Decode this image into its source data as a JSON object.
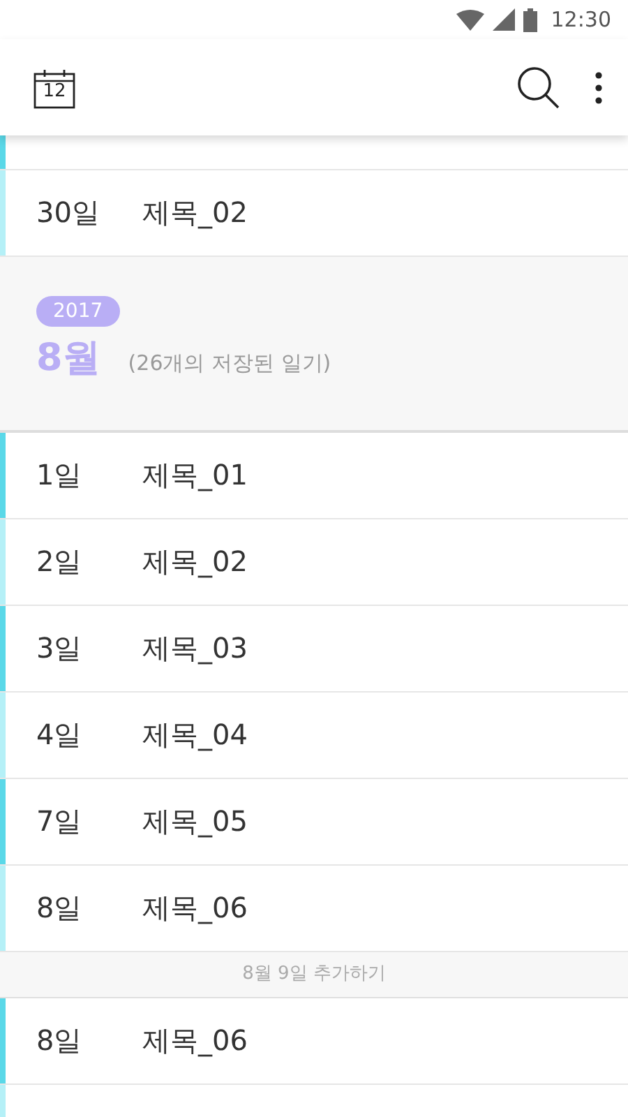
{
  "status_bar": {
    "time": "12:30"
  },
  "toolbar": {
    "calendar_day": "12"
  },
  "clipped_row": {
    "color": "#5ad8e8"
  },
  "previous_entries": [
    {
      "day": "30일",
      "title": "제목_02",
      "color": "#b5f0f7"
    }
  ],
  "month_header": {
    "year": "2017",
    "month": "8월",
    "count": "(26개의 저장된 일기)"
  },
  "entries": [
    {
      "kind": "entry",
      "day": "1일",
      "title": "제목_01",
      "color": "#5ad8e8"
    },
    {
      "kind": "entry",
      "day": "2일",
      "title": "제목_02",
      "color": "#b5f0f7"
    },
    {
      "kind": "entry",
      "day": "3일",
      "title": "제목_03",
      "color": "#5ad8e8"
    },
    {
      "kind": "entry",
      "day": "4일",
      "title": "제목_04",
      "color": "#b5f0f7"
    },
    {
      "kind": "entry",
      "day": "7일",
      "title": "제목_05",
      "color": "#5ad8e8"
    },
    {
      "kind": "entry",
      "day": "8일",
      "title": "제목_06",
      "color": "#b5f0f7"
    },
    {
      "kind": "add",
      "label": "8월 9일 추가하기"
    },
    {
      "kind": "entry",
      "day": "8일",
      "title": "제목_06",
      "color": "#5ad8e8"
    },
    {
      "kind": "entry",
      "color": "#b5f0f7"
    }
  ]
}
